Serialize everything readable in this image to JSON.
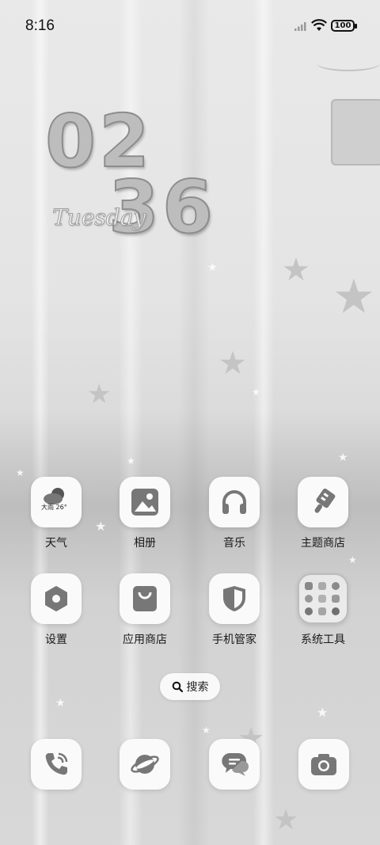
{
  "status_bar": {
    "time": "8:16",
    "battery": "100"
  },
  "clock_widget": {
    "hours": "02",
    "minutes": "36",
    "day": "Tuesday"
  },
  "apps": [
    {
      "label": "天气",
      "icon": "weather-icon",
      "badge": "大雨 26°"
    },
    {
      "label": "相册",
      "icon": "gallery-icon"
    },
    {
      "label": "音乐",
      "icon": "headphones-icon"
    },
    {
      "label": "主题商店",
      "icon": "theme-brush-icon"
    },
    {
      "label": "设置",
      "icon": "settings-hexagon-icon"
    },
    {
      "label": "应用商店",
      "icon": "shopping-bag-icon"
    },
    {
      "label": "手机管家",
      "icon": "shield-icon"
    },
    {
      "label": "系统工具",
      "icon": "folder-icon"
    }
  ],
  "search": {
    "label": "搜索"
  },
  "dock": [
    {
      "icon": "phone-icon"
    },
    {
      "icon": "browser-planet-icon"
    },
    {
      "icon": "messages-icon"
    },
    {
      "icon": "camera-icon"
    }
  ]
}
